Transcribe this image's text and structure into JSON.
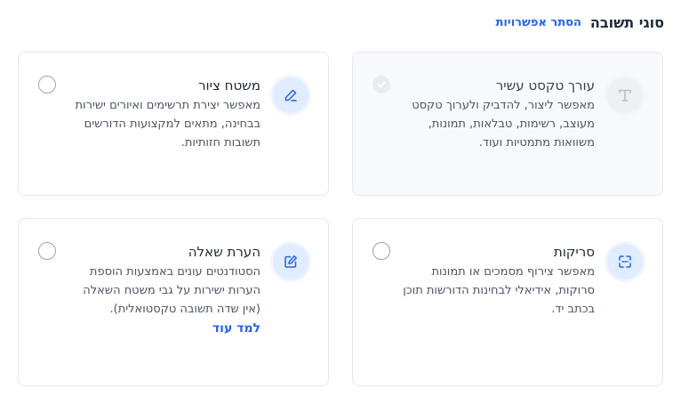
{
  "header": {
    "title": "סוגי תשובה",
    "toggle_link": "הסתר אפשרויות"
  },
  "cards": [
    {
      "title": "עורך טקסט עשיר",
      "description": "מאפשר ליצור, להדביק ולערוך טקסט מעוצב, רשימות, טבלאות, תמונות, משוואות מתמטיות ועוד.",
      "icon": "text-format-icon",
      "state": "disabled-checked"
    },
    {
      "title": "משטח ציור",
      "description": "מאפשר יצירת תרשימים ואיורים ישירות בבחינה, מתאים למקצועות הדורשים תשובות חזותיות.",
      "icon": "pencil-icon",
      "state": "unchecked"
    },
    {
      "title": "סריקות",
      "description": "מאפשר צירוף מסמכים או תמונות סרוקות, אידיאלי לבחינות הדורשות תוכן בכתב יד.",
      "icon": "scan-icon",
      "state": "unchecked"
    },
    {
      "title": "הערת שאלה",
      "description": "הסטודנטים עונים באמצעות הוספת הערות ישירות על גבי משטח השאלה (אין שדה תשובה טקסטואלית).",
      "link": "למד עוד",
      "icon": "note-edit-icon",
      "state": "unchecked"
    }
  ],
  "colors": {
    "accent": "#2563eb",
    "icon_badge_bg": "#e0ecff",
    "disabled_card_bg": "#f7f9fc"
  }
}
